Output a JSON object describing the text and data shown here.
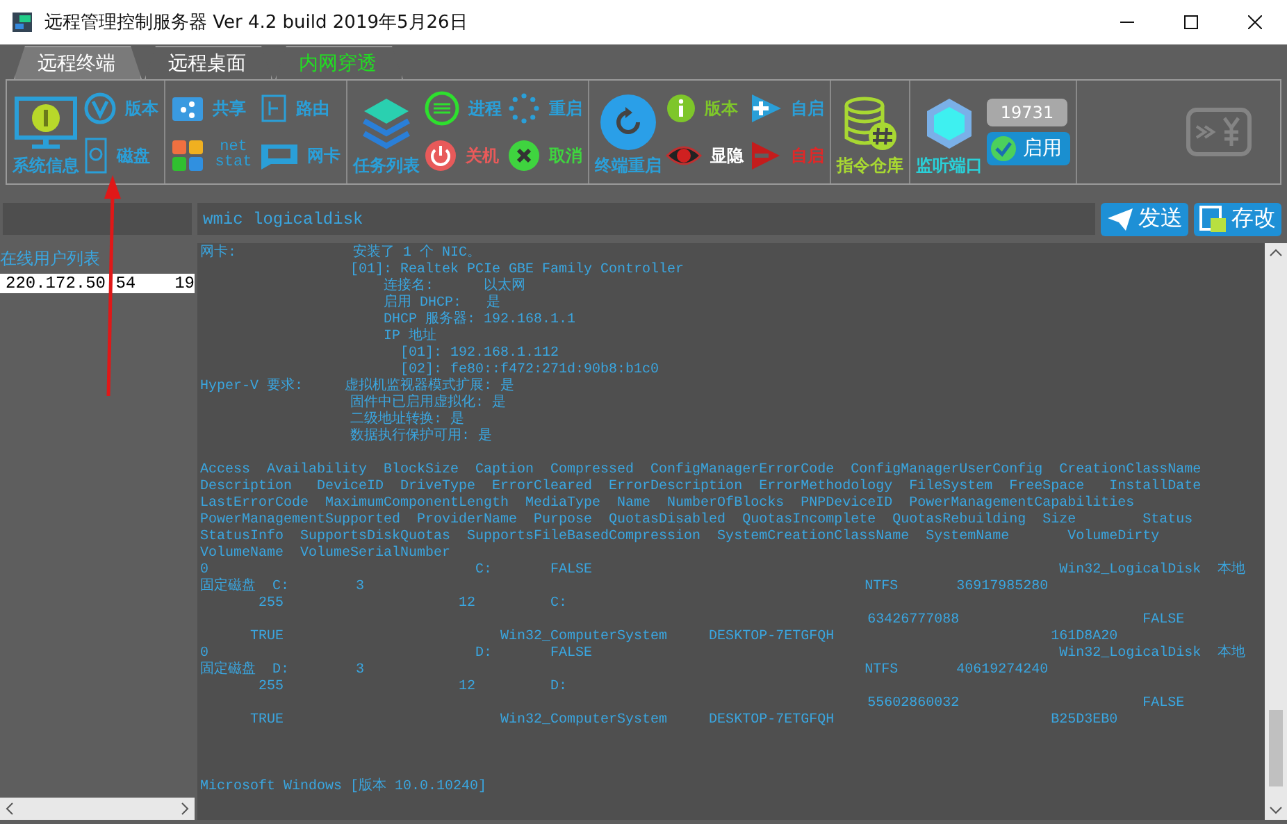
{
  "window": {
    "title": "远程管理控制服务器 Ver 4.2 build 2019年5月26日"
  },
  "tabs": [
    {
      "label": "远程终端",
      "selected": true,
      "color": "#ffffff"
    },
    {
      "label": "远程桌面",
      "selected": false,
      "color": "#ffffff"
    },
    {
      "label": "内网穿透",
      "selected": false,
      "color": "#22dd22"
    }
  ],
  "toolbar": {
    "groups": [
      {
        "items": [
          {
            "kind": "large",
            "label": "系统信息",
            "color": "#2a9fd8"
          },
          {
            "kind": "small",
            "label": "版本",
            "color": "#2a9fd8"
          },
          {
            "kind": "small",
            "label": "磁盘",
            "color": "#2a9fd8"
          }
        ]
      },
      {
        "items": [
          {
            "kind": "small",
            "label": "共享",
            "color": "#2a9fd8"
          },
          {
            "kind": "small",
            "label": "net stat",
            "color": "#2a9fd8"
          },
          {
            "kind": "small",
            "label": "路由",
            "color": "#2a9fd8"
          },
          {
            "kind": "small",
            "label": "网卡",
            "color": "#2a9fd8"
          }
        ]
      },
      {
        "items": [
          {
            "kind": "large",
            "label": "任务列表",
            "color": "#2a9fd8"
          },
          {
            "kind": "small",
            "label": "进程",
            "color": "#2a9fd8"
          },
          {
            "kind": "small",
            "label": "关机",
            "color": "#e85a5a"
          },
          {
            "kind": "small",
            "label": "重启",
            "color": "#2a9fd8"
          },
          {
            "kind": "small",
            "label": "取消",
            "color": "#3fd43f"
          }
        ]
      },
      {
        "items": [
          {
            "kind": "large",
            "label": "终端重启",
            "color": "#2a9fd8"
          },
          {
            "kind": "small",
            "label": "版本",
            "color": "#7ec62a"
          },
          {
            "kind": "small",
            "label": "显隐",
            "color": "#ffffff"
          },
          {
            "kind": "small",
            "label": "自启",
            "color": "#2a9fd8"
          },
          {
            "kind": "small",
            "label": "自启",
            "color": "#e02828"
          }
        ]
      },
      {
        "items": [
          {
            "kind": "large",
            "label": "指令仓库",
            "color": "#a8d832"
          }
        ]
      },
      {
        "items": [
          {
            "kind": "large",
            "label": "监听端口",
            "color": "#2ad0d8"
          },
          {
            "kind": "port",
            "value": "19731"
          },
          {
            "kind": "toggle",
            "label": "启用",
            "on": true
          }
        ]
      }
    ]
  },
  "command": {
    "value": "wmic logicaldisk"
  },
  "buttons": [
    "发送",
    "存改"
  ],
  "users": {
    "title": "在线用户列表",
    "rows": [
      {
        "address": "220.172.50.54",
        "port": "19",
        "selected": true
      }
    ]
  },
  "output": [
    [
      "网卡:              安装了 1 个 NIC。",
      "                  [01]: Realtek PCIe GBE Family Controller",
      "                      连接名:      以太网",
      "                      启用 DHCP:   是",
      "                      DHCP 服务器: 192.168.1.1",
      "                      IP 地址",
      "                        [01]: 192.168.1.112",
      "                        [02]: fe80::f472:271d:90b8:b1c0",
      "Hyper-V 要求:     虚拟机监视器模式扩展: 是",
      "                  固件中已启用虚拟化: 是",
      "                  二级地址转换: 是",
      "                  数据执行保护可用: 是"
    ],
    [
      "Access  Availability  BlockSize  Caption  Compressed  ConfigManagerErrorCode  ConfigManagerUserConfig  CreationClassName",
      "Description   DeviceID  DriveType  ErrorCleared  ErrorDescription  ErrorMethodology  FileSystem  FreeSpace   InstallDate",
      "LastErrorCode  MaximumComponentLength  MediaType  Name  NumberOfBlocks  PNPDeviceID  PowerManagementCapabilities",
      "PowerManagementSupported  ProviderName  Purpose  QuotasDisabled  QuotasIncomplete  QuotasRebuilding  Size        Status",
      "StatusInfo  SupportsDiskQuotas  SupportsFileBasedCompression  SystemCreationClassName  SystemName       VolumeDirty",
      "VolumeName  VolumeSerialNumber",
      "0                                C:       FALSE                                                        Win32_LogicalDisk  本地",
      "固定磁盘  C:        3                                                            NTFS       36917985280",
      "       255                     12         C:",
      "                                                                                63426777088                      FALSE",
      "      TRUE                          Win32_ComputerSystem     DESKTOP-7ETGFQH                          161D8A20",
      "0                                D:       FALSE                                                        Win32_LogicalDisk  本地",
      "固定磁盘  D:        3                                                            NTFS       40619274240",
      "       255                     12         D:",
      "                                                                                55602860032                      FALSE",
      "      TRUE                          Win32_ComputerSystem     DESKTOP-7ETGFQH                          B25D3EB0"
    ],
    [
      "Microsoft Windows [版本 10.0.10240]"
    ]
  ]
}
